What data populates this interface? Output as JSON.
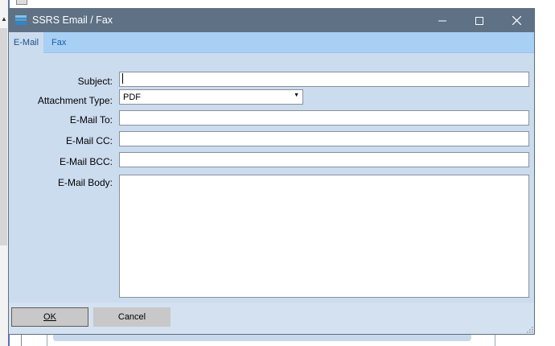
{
  "window": {
    "title": "SSRS Email / Fax",
    "minimize_icon": "minimize-icon",
    "maximize_icon": "maximize-icon",
    "close_icon": "close-icon",
    "app_icon": "envelope-stack-icon"
  },
  "tabs": [
    {
      "label": "E-Mail",
      "active": true
    },
    {
      "label": "Fax",
      "active": false
    }
  ],
  "form": {
    "subject_label": "Subject:",
    "subject_value": "",
    "attachment_type_label": "Attachment Type:",
    "attachment_type_value": "PDF",
    "email_to_label": "E-Mail To:",
    "email_to_value": "",
    "email_cc_label": "E-Mail CC:",
    "email_cc_value": "",
    "email_bcc_label": "E-Mail BCC:",
    "email_bcc_value": "",
    "email_body_label": "E-Mail Body:",
    "email_body_value": ""
  },
  "buttons": {
    "ok_label": "OK",
    "cancel_label": "Cancel"
  },
  "colors": {
    "titlebar": "#5e7185",
    "tabstrip": "#a8cff4",
    "body": "#ccdcef"
  }
}
